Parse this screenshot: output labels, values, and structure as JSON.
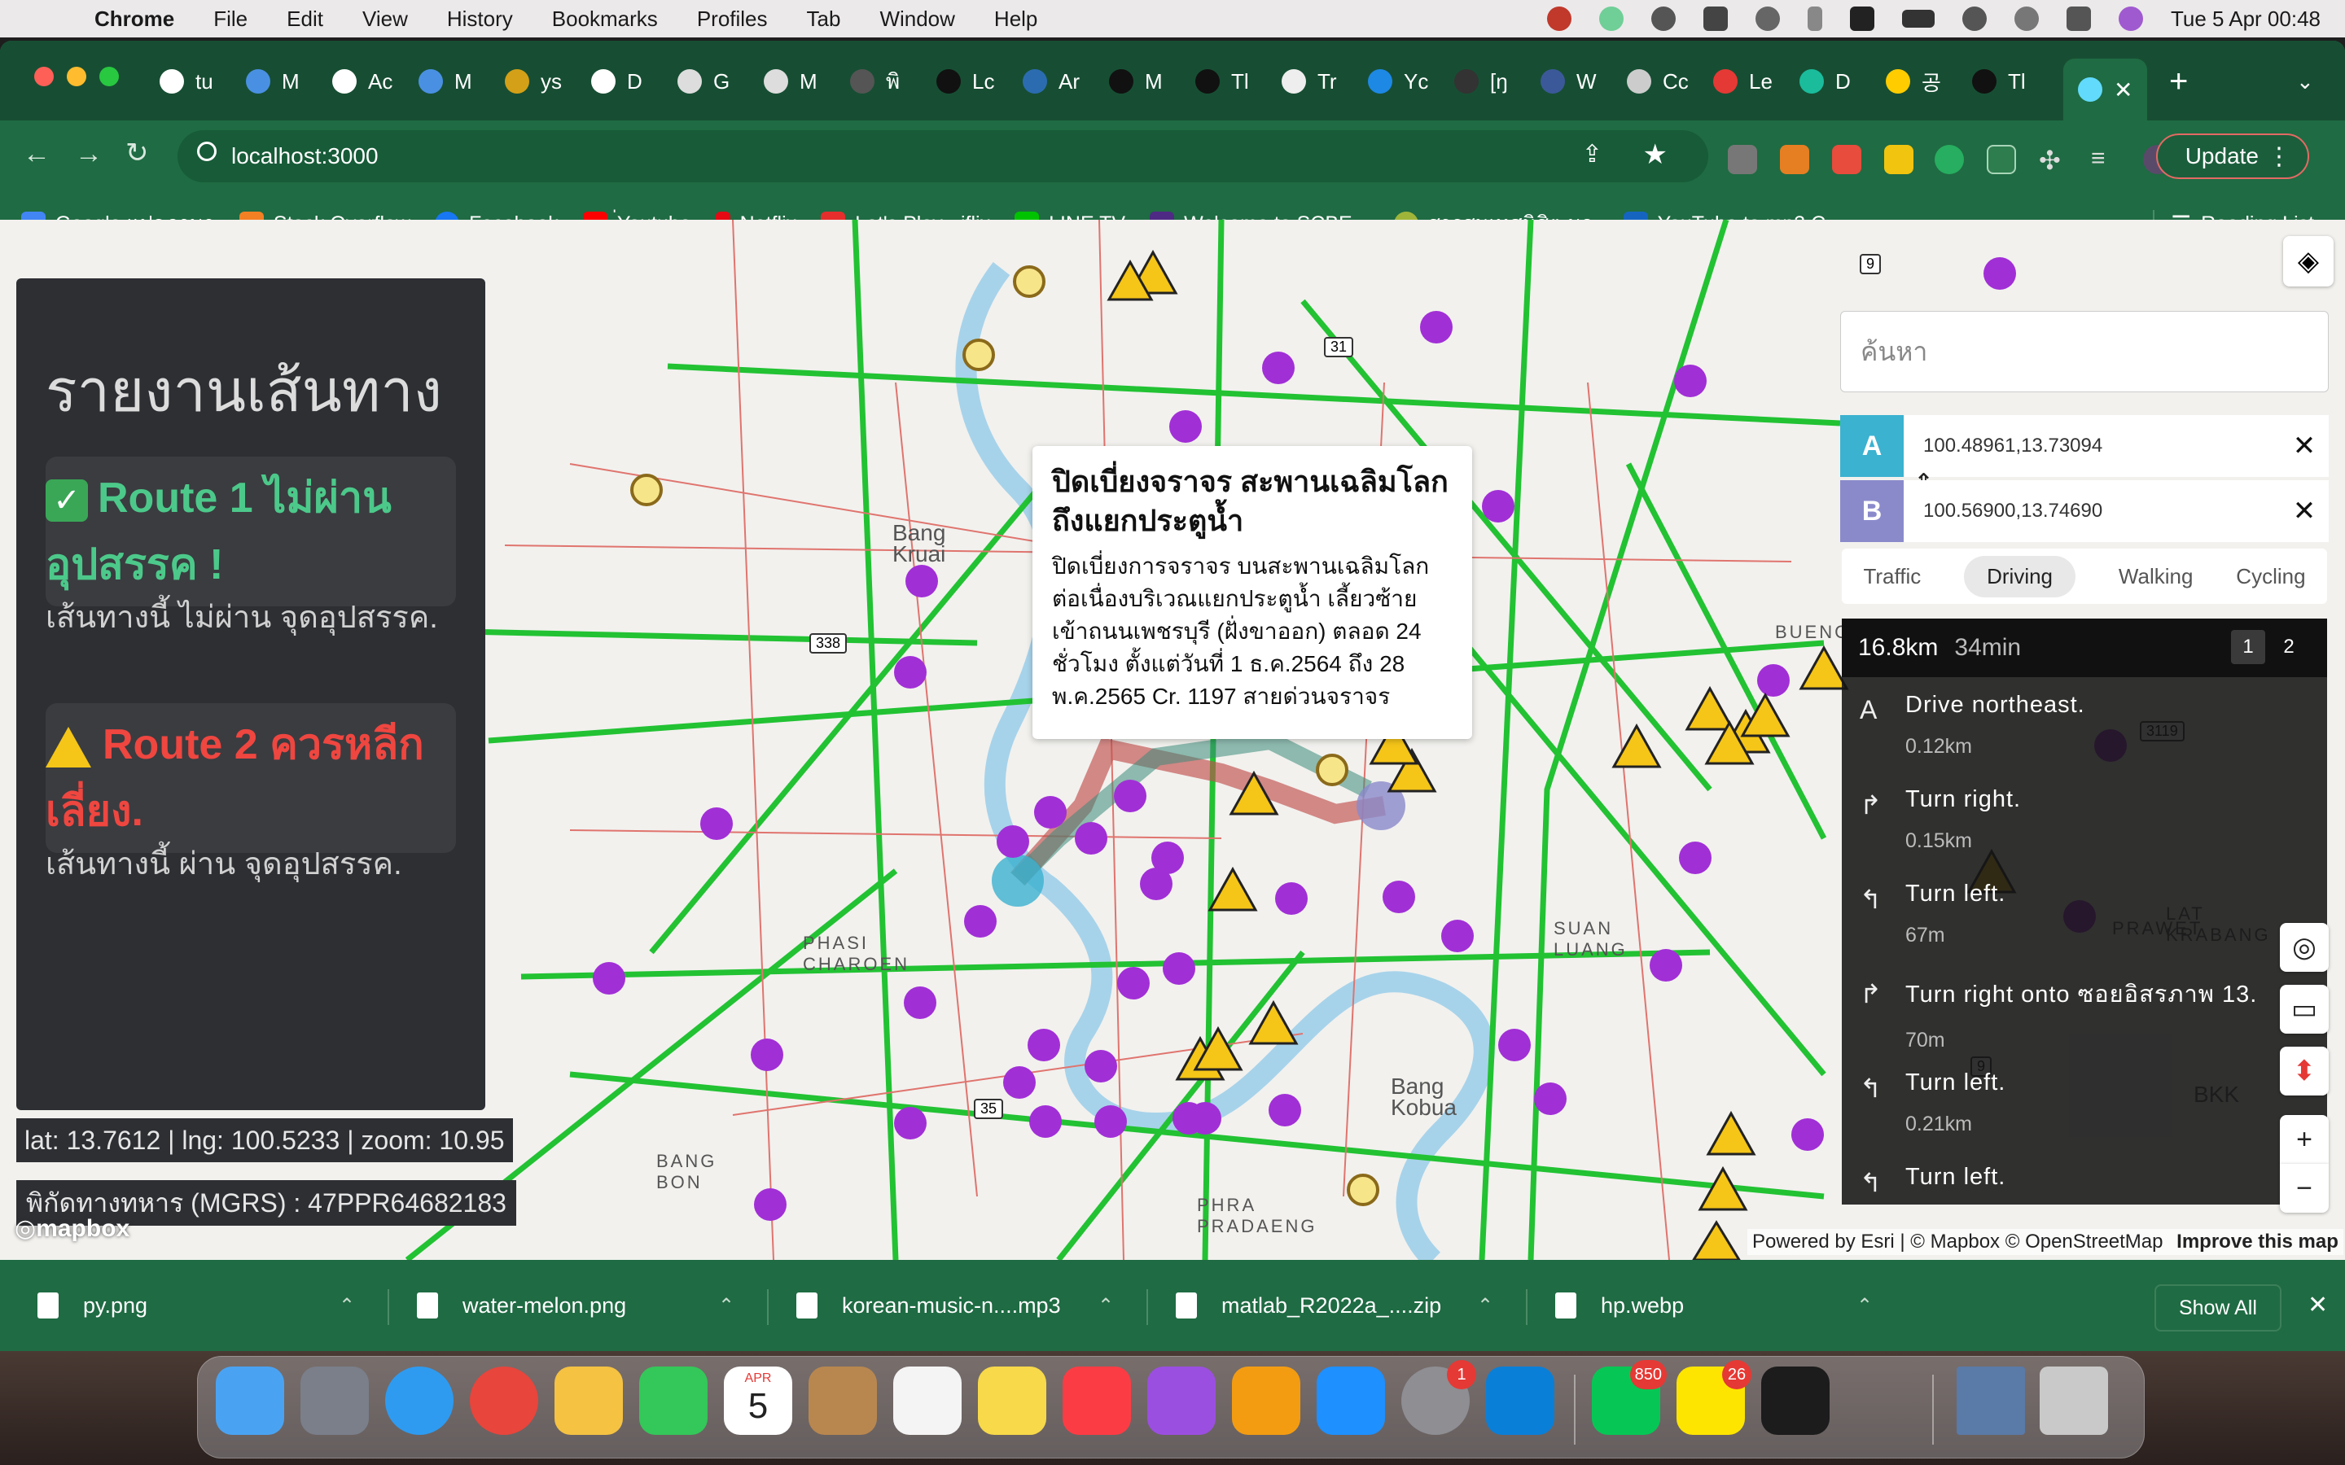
{
  "menubar": {
    "app_name": "Chrome",
    "items": [
      "File",
      "Edit",
      "View",
      "History",
      "Bookmarks",
      "Profiles",
      "Tab",
      "Window",
      "Help"
    ],
    "clock": "Tue 5 Apr  00:48"
  },
  "browser": {
    "tabs": [
      "tu",
      "M",
      "Ac",
      "M",
      "ys",
      "D",
      "G",
      "M",
      "พิ",
      "Lc",
      "Ar",
      "M",
      "Tl",
      "Tr",
      "Yc",
      "[ŋ",
      "W",
      "Cc",
      "Le",
      "D",
      "공",
      "Tl"
    ],
    "new_tab_label": "+",
    "url": "localhost:3000",
    "update_label": "Update",
    "bookmarks": [
      {
        "label": "Google แปลภาษา",
        "color": "#4285f4"
      },
      {
        "label": "Stack Overflow",
        "color": "#f48024"
      },
      {
        "label": "Facebook",
        "color": "#1877f2"
      },
      {
        "label": "่Youtube",
        "color": "#ff0000"
      },
      {
        "label": "Netflix",
        "color": "#e50914"
      },
      {
        "label": "Let's Play - iflix",
        "color": "#e62e2d"
      },
      {
        "label": "LINE TV",
        "color": "#00c300"
      },
      {
        "label": "Welcome to SCBE...",
        "color": "#4e2a84"
      },
      {
        "label": "สารสนเทศนิสิต มก.",
        "color": "#2e7d32"
      },
      {
        "label": "YouTube to mp3 C...",
        "color": "#1565c0"
      }
    ],
    "bookmarks_more": "»",
    "reading_list": "Reading List"
  },
  "panel": {
    "title": "รายงานเส้นทาง",
    "route1_label": "Route 1 ไม่ผ่าน อุปสรรค !",
    "route1_note": "เส้นทางนี้ ไม่ผ่าน จุดอุปสรรค.",
    "route2_label": "Route 2 ควรหลีก เลี่ยง.",
    "route2_note": "เส้นทางนี้ ผ่าน จุดอุปสรรค."
  },
  "map": {
    "coords": "lat: 13.7612 | lng: 100.5233 | zoom: 10.95",
    "mgrs": "พิกัดทางทหาร (MGRS) : 47PPR64682183",
    "logo": "mapbox",
    "place_labels": [
      "Bang Kruai",
      "PHASI CHAROEN",
      "BANG BON",
      "PHRA PRADAENG",
      "Bang Kobua",
      "SUAN LUANG",
      "LAT KRABANG",
      "BUENG",
      "PRAWET",
      "BKK"
    ],
    "road_shields": [
      "9",
      "31",
      "338",
      "35",
      "3119",
      "9"
    ],
    "attribution": "Powered by Esri | © Mapbox © OpenStreetMap",
    "improve": "Improve this map"
  },
  "popup": {
    "title": "ปิดเบี่ยงจราจร สะพานเฉลิมโลก ถึงแยกประตูน้ำ",
    "body": "ปิดเบี่ยงการจราจร บนสะพานเฉลิมโลกต่อเนื่องบริเวณแยกประตูน้ำ เลี้ยวซ้ายเข้าถนนเพชรบุรี (ฝั่งขาออก) ตลอด 24 ชั่วโมง ตั้งแต่วันที่ 1 ธ.ค.2564 ถึง 28 พ.ค.2565 Cr. 1197 สายด่วนจราจร"
  },
  "search": {
    "placeholder": "ค้นหา"
  },
  "directions": {
    "origin_label": "A",
    "origin_value": "100.48961,13.73094",
    "destination_label": "B",
    "destination_value": "100.56900,13.74690",
    "close_glyph": "✕",
    "profiles": [
      "Traffic",
      "Driving",
      "Walking",
      "Cycling"
    ],
    "active_profile": "Driving",
    "summary_distance": "16.8km",
    "summary_duration": "34min",
    "alternatives": [
      "1",
      "2"
    ],
    "steps": [
      {
        "icon": "A",
        "text": "Drive northeast.",
        "distance": "0.12km"
      },
      {
        "icon": "↱",
        "text": "Turn right.",
        "distance": "0.15km"
      },
      {
        "icon": "↰",
        "text": "Turn left.",
        "distance": "67m"
      },
      {
        "icon": "↱",
        "text": "Turn right onto ซอยอิสรภาพ 13.",
        "distance": "70m"
      },
      {
        "icon": "↰",
        "text": "Turn left.",
        "distance": "0.21km"
      },
      {
        "icon": "↰",
        "text": "Turn left.",
        "distance": ""
      }
    ]
  },
  "downloads": {
    "items": [
      "py.png",
      "water-melon.png",
      "korean-music-n....mp3",
      "matlab_R2022a_....zip",
      "hp.webp"
    ],
    "show_all": "Show All",
    "close_glyph": "✕"
  },
  "dock": {
    "badges": {
      "settings": "1",
      "line": "850",
      "kakaotalk": "26"
    },
    "calendar_month": "APR",
    "calendar_day": "5"
  },
  "colors": {
    "route1": "#4cc98a",
    "route2": "#ef4640",
    "origin": "#3bb2d0",
    "destination": "#8a8acb",
    "chrome_theme": "#1f6b43",
    "traffic_green": "#22c233",
    "hospital_purple": "#a12fd6",
    "warning_yellow": "#f5c518"
  }
}
